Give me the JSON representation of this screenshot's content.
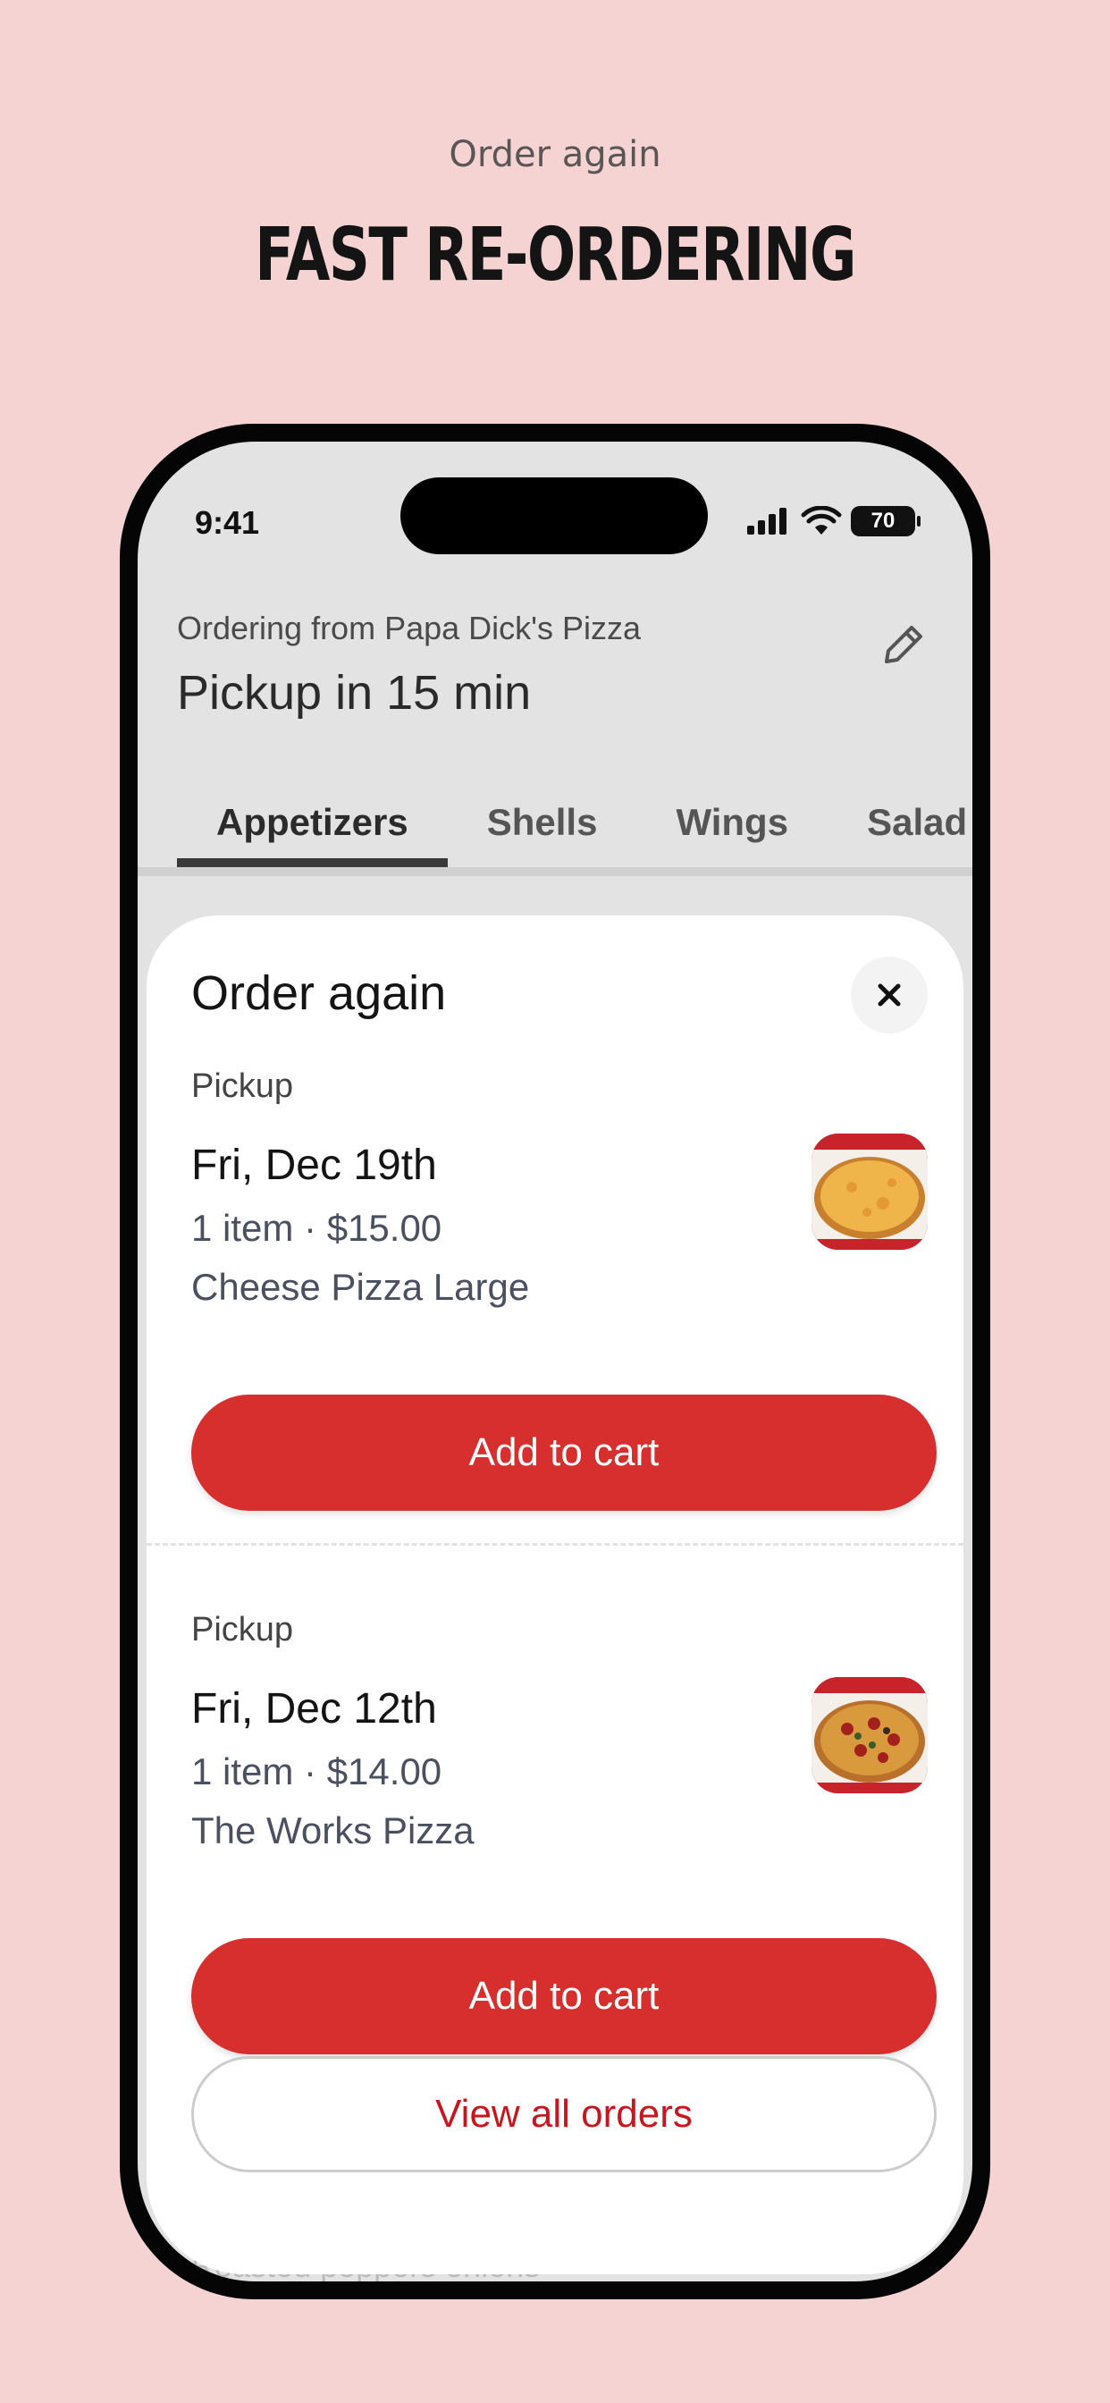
{
  "promo": {
    "subtitle": "Order again",
    "title": "FAST RE-ORDERING"
  },
  "status_bar": {
    "time": "9:41",
    "battery": "70"
  },
  "header": {
    "ordering_from": "Ordering from Papa Dick's Pizza",
    "pickup_eta": "Pickup in 15 min"
  },
  "tabs": [
    {
      "label": "Appetizers",
      "active": true
    },
    {
      "label": "Shells",
      "active": false
    },
    {
      "label": "Wings",
      "active": false
    },
    {
      "label": "Salad",
      "active": false
    }
  ],
  "background_hint": "Roasted peppers onions",
  "sheet": {
    "title": "Order again",
    "orders": [
      {
        "type": "Pickup",
        "date": "Fri, Dec 19th",
        "summary": "1 item · $15.00",
        "item": "Cheese Pizza Large",
        "button": "Add to cart",
        "thumb_icon": "cheese-pizza-image"
      },
      {
        "type": "Pickup",
        "date": "Fri, Dec 12th",
        "summary": "1 item · $14.00",
        "item": "The Works Pizza",
        "button": "Add to cart",
        "thumb_icon": "works-pizza-image"
      }
    ],
    "view_all": "View all orders"
  },
  "colors": {
    "background": "#F5D3D3",
    "accent_red": "#D72E2E",
    "link_red": "#C8161E"
  }
}
